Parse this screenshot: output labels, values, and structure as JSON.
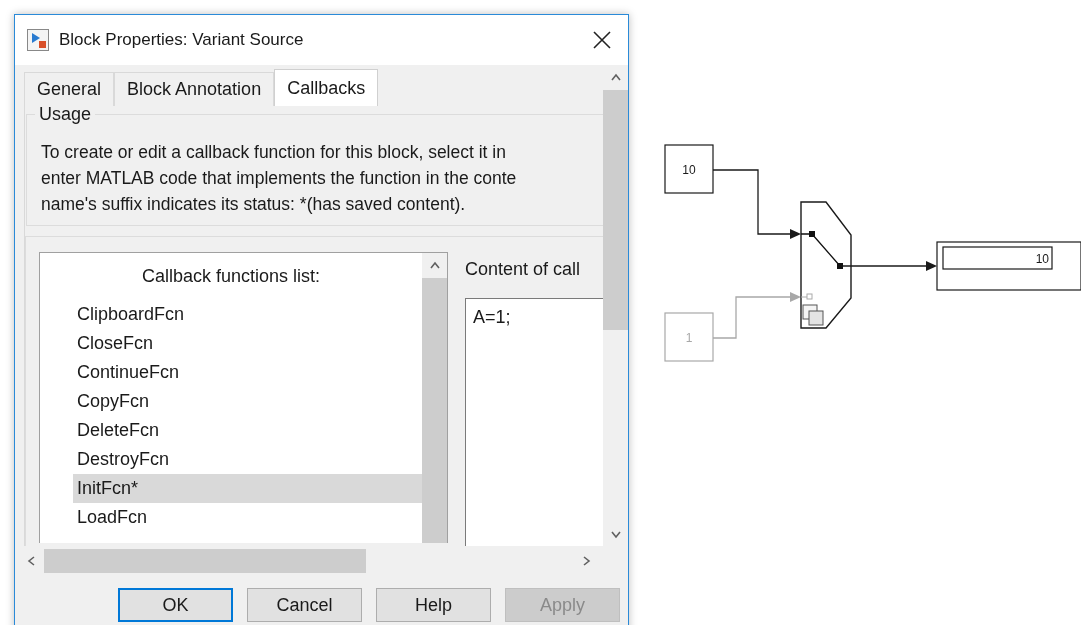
{
  "window": {
    "title": "Block Properties: Variant Source"
  },
  "tabs": [
    {
      "label": "General",
      "selected": false
    },
    {
      "label": "Block Annotation",
      "selected": false
    },
    {
      "label": "Callbacks",
      "selected": true
    }
  ],
  "usage": {
    "legend": "Usage",
    "text": "To create or edit a callback function for this block, select it in\nenter MATLAB code that implements the function in the conte\nname's suffix indicates its status: *(has saved content)."
  },
  "callback_list": {
    "title": "Callback functions list:",
    "items": [
      {
        "label": "ClipboardFcn",
        "selected": false
      },
      {
        "label": "CloseFcn",
        "selected": false
      },
      {
        "label": "ContinueFcn",
        "selected": false
      },
      {
        "label": "CopyFcn",
        "selected": false
      },
      {
        "label": "DeleteFcn",
        "selected": false
      },
      {
        "label": "DestroyFcn",
        "selected": false
      },
      {
        "label": "InitFcn*",
        "selected": true
      },
      {
        "label": "LoadFcn",
        "selected": false
      }
    ]
  },
  "content": {
    "label": "Content of call",
    "value": "A=1;"
  },
  "buttons": [
    {
      "label": "OK",
      "focused": true,
      "disabled": false
    },
    {
      "label": "Cancel",
      "focused": false,
      "disabled": false
    },
    {
      "label": "Help",
      "focused": false,
      "disabled": false
    },
    {
      "label": "Apply",
      "focused": false,
      "disabled": true
    }
  ],
  "diagram": {
    "blocks": [
      {
        "kind": "constant",
        "value": "10",
        "active": true
      },
      {
        "kind": "constant",
        "value": "1",
        "active": false
      },
      {
        "kind": "display",
        "value": "10",
        "active": true
      }
    ]
  }
}
